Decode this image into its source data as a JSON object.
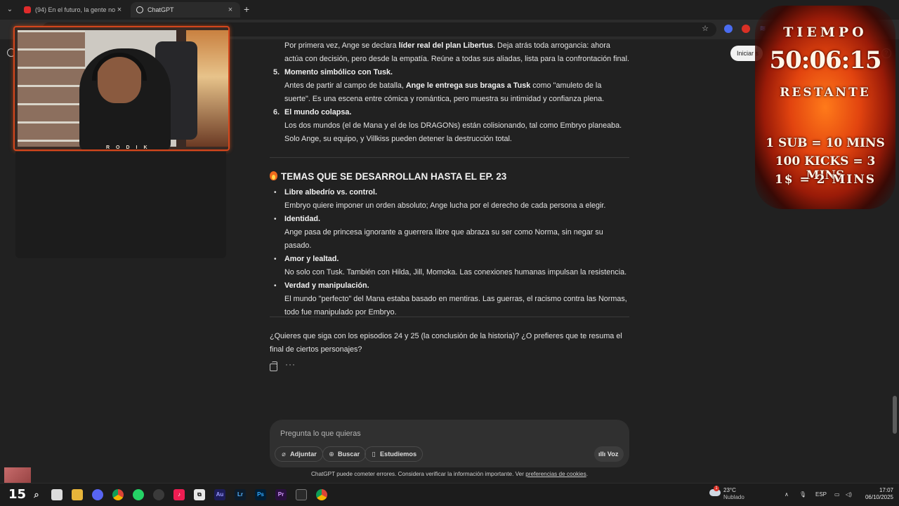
{
  "browser": {
    "tabs": [
      {
        "title": "(94) En el futuro, la gente norm",
        "active": false
      },
      {
        "title": "ChatGPT",
        "active": true
      }
    ],
    "new_tab": "+",
    "close": "×"
  },
  "page": {
    "intro": {
      "p1": "Por primera vez, Ange se declara ",
      "p1_bold": "líder real del plan Libertus",
      "p1_rest": ". Deja atrás toda arrogancia: ahora actúa con decisión, pero desde la empatía. Reúne a todas sus aliadas, lista para la confrontación final."
    },
    "list": [
      {
        "num": "5.",
        "title": "Momento simbólico con Tusk.",
        "t1": "Antes de partir al campo de batalla, ",
        "t1_bold": "Ange le entrega sus bragas a Tusk",
        "t1_rest": " como \"amuleto de la suerte\". Es una escena entre cómica y romántica, pero muestra su intimidad y confianza plena."
      },
      {
        "num": "6.",
        "title": "El mundo colapsa.",
        "t1": "Los dos mundos (el de Mana y el de los DRAGONs) están colisionando, tal como Embryo planeaba. Solo Ange, su equipo, y Villkiss pueden detener la destrucción total.",
        "t1_bold": "",
        "t1_rest": ""
      }
    ],
    "heading": "TEMAS QUE SE DESARROLLAN HASTA EL EP. 23",
    "themes": [
      {
        "title": "Libre albedrío vs. control.",
        "text": "Embryo quiere imponer un orden absoluto; Ange lucha por el derecho de cada persona a elegir."
      },
      {
        "title": "Identidad.",
        "text": "Ange pasa de princesa ignorante a guerrera libre que abraza su ser como Norma, sin negar su pasado."
      },
      {
        "title": "Amor y lealtad.",
        "text": "No solo con Tusk. También con Hilda, Jill, Momoka. Las conexiones humanas impulsan la resistencia."
      },
      {
        "title": "Verdad y manipulación.",
        "text": "El mundo \"perfecto\" del Mana estaba basado en mentiras. Las guerras, el racismo contra las Normas, todo fue manipulado por Embryo."
      }
    ],
    "bullet": "•",
    "question": "¿Quieres que siga con los episodios 24 y 25 (la conclusión de la historia)? ¿O prefieres que te resuma el final de ciertos personajes?",
    "more": "···",
    "login_button": "Iniciar s",
    "help": "?",
    "composer": {
      "placeholder": "Pregunta lo que quieras",
      "buttons": {
        "attach": "Adjuntar",
        "search": "Buscar",
        "study": "Estudiemos",
        "voice": "Voz"
      }
    },
    "disclaimer": "ChatGPT puede cometer errores. Considera verificar la información importante. Ver ",
    "disclaimer_link": "preferencias de cookies",
    "disclaimer_end": "."
  },
  "overlay": {
    "timer": {
      "label": "TIEMPO",
      "value": "50:06:15",
      "sublabel": "RESTANTE",
      "rates": [
        "1 SUB = 10 MINS",
        "100 KICKS = 3 MINS",
        "1$ = 2 MINS"
      ]
    },
    "webcam_caption": "RODIK",
    "thumb_number": "15"
  },
  "taskbar": {
    "weather_temp": "23°C",
    "weather_desc": "Nublado",
    "weather_badge": "1",
    "lang": "ESP",
    "time": "17:07",
    "date": "06/10/2025"
  },
  "colors": {
    "background": "#212121",
    "accent_fire": "#e2440f",
    "text": "#e3e3e3"
  }
}
